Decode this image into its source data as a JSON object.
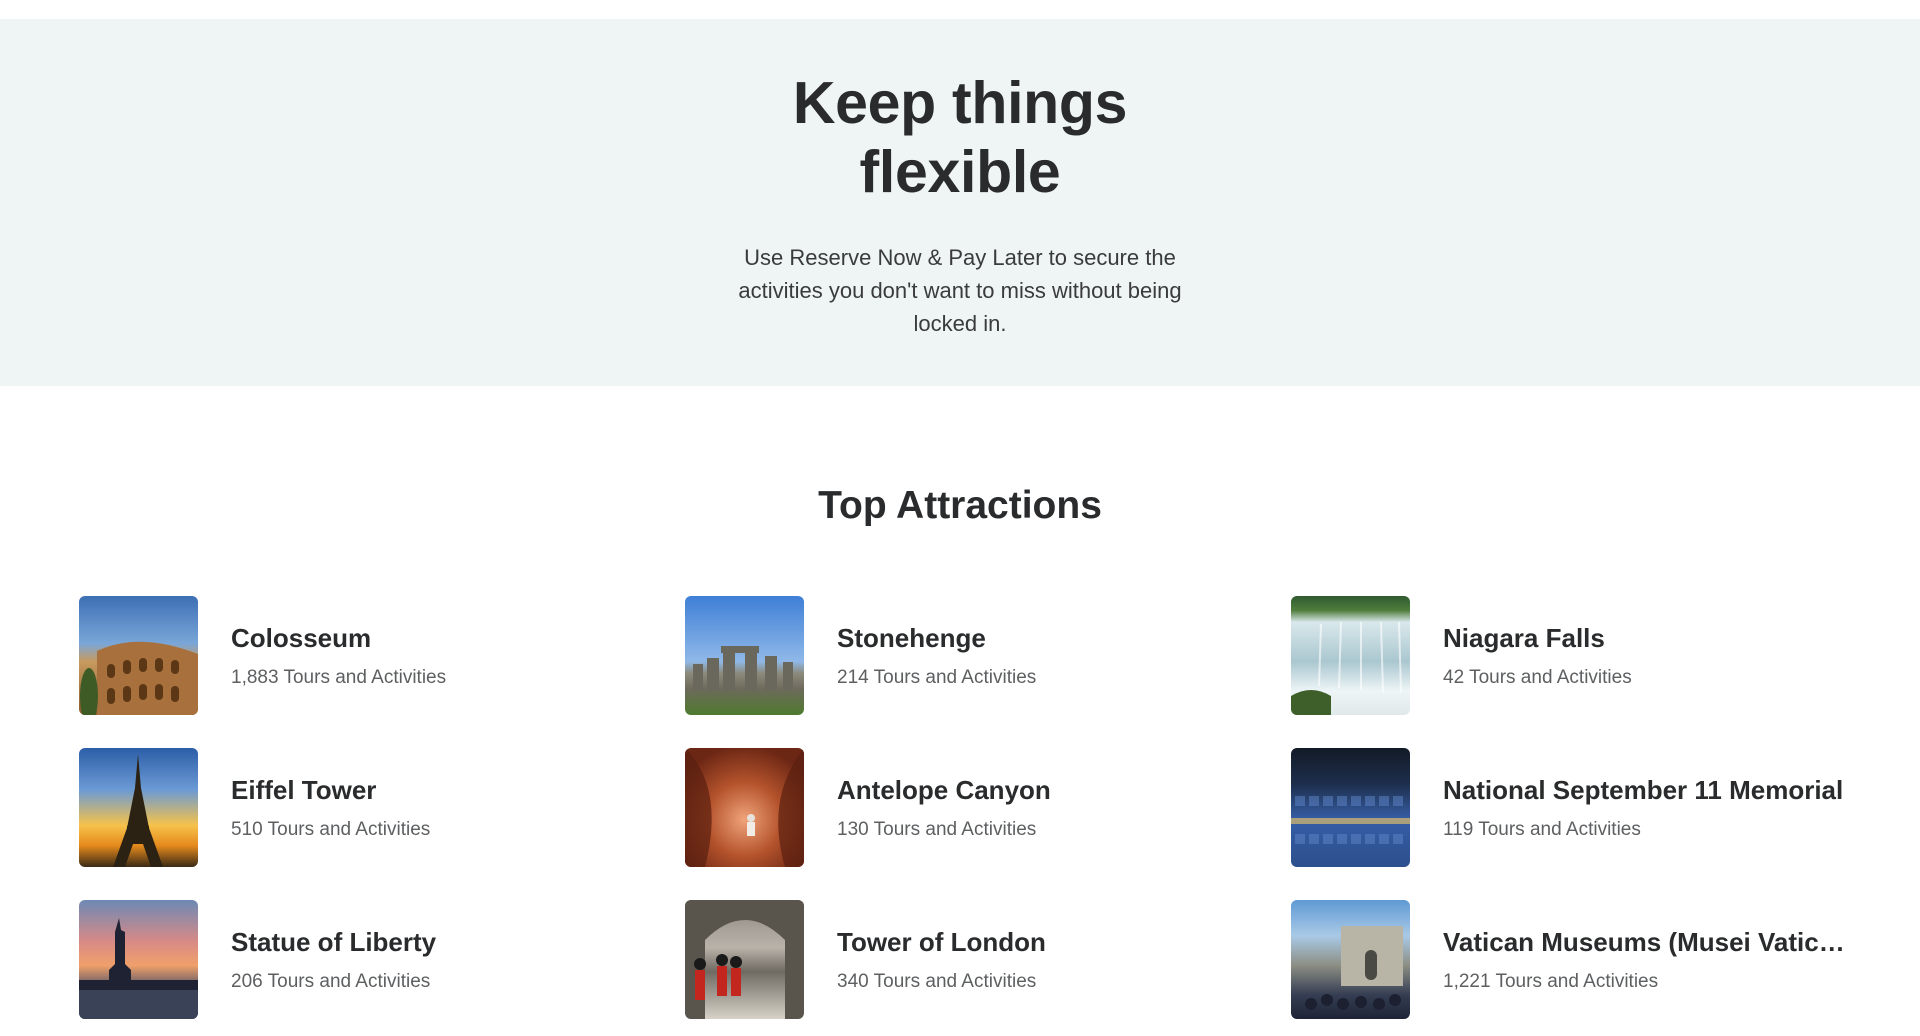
{
  "hero": {
    "title": "Keep things flexible",
    "description": "Use Reserve Now & Pay Later to secure the activities you don't want to miss without being locked in."
  },
  "attractions": {
    "heading": "Top Attractions",
    "items": [
      {
        "name": "Colosseum",
        "count": "1,883 Tours and Activities",
        "image": "colosseum-photo"
      },
      {
        "name": "Stonehenge",
        "count": "214 Tours and Activities",
        "image": "stonehenge-photo"
      },
      {
        "name": "Niagara Falls",
        "count": "42 Tours and Activities",
        "image": "niagara-falls-photo"
      },
      {
        "name": "Eiffel Tower",
        "count": "510 Tours and Activities",
        "image": "eiffel-tower-photo"
      },
      {
        "name": "Antelope Canyon",
        "count": "130 Tours and Activities",
        "image": "antelope-canyon-photo"
      },
      {
        "name": "National September 11 Memorial",
        "count": "119 Tours and Activities",
        "image": "september-11-memorial-photo"
      },
      {
        "name": "Statue of Liberty",
        "count": "206 Tours and Activities",
        "image": "statue-of-liberty-photo"
      },
      {
        "name": "Tower of London",
        "count": "340 Tours and Activities",
        "image": "tower-of-london-photo"
      },
      {
        "name": "Vatican Museums (Musei Vaticani)",
        "count": "1,221 Tours and Activities",
        "image": "vatican-museums-photo"
      }
    ]
  }
}
